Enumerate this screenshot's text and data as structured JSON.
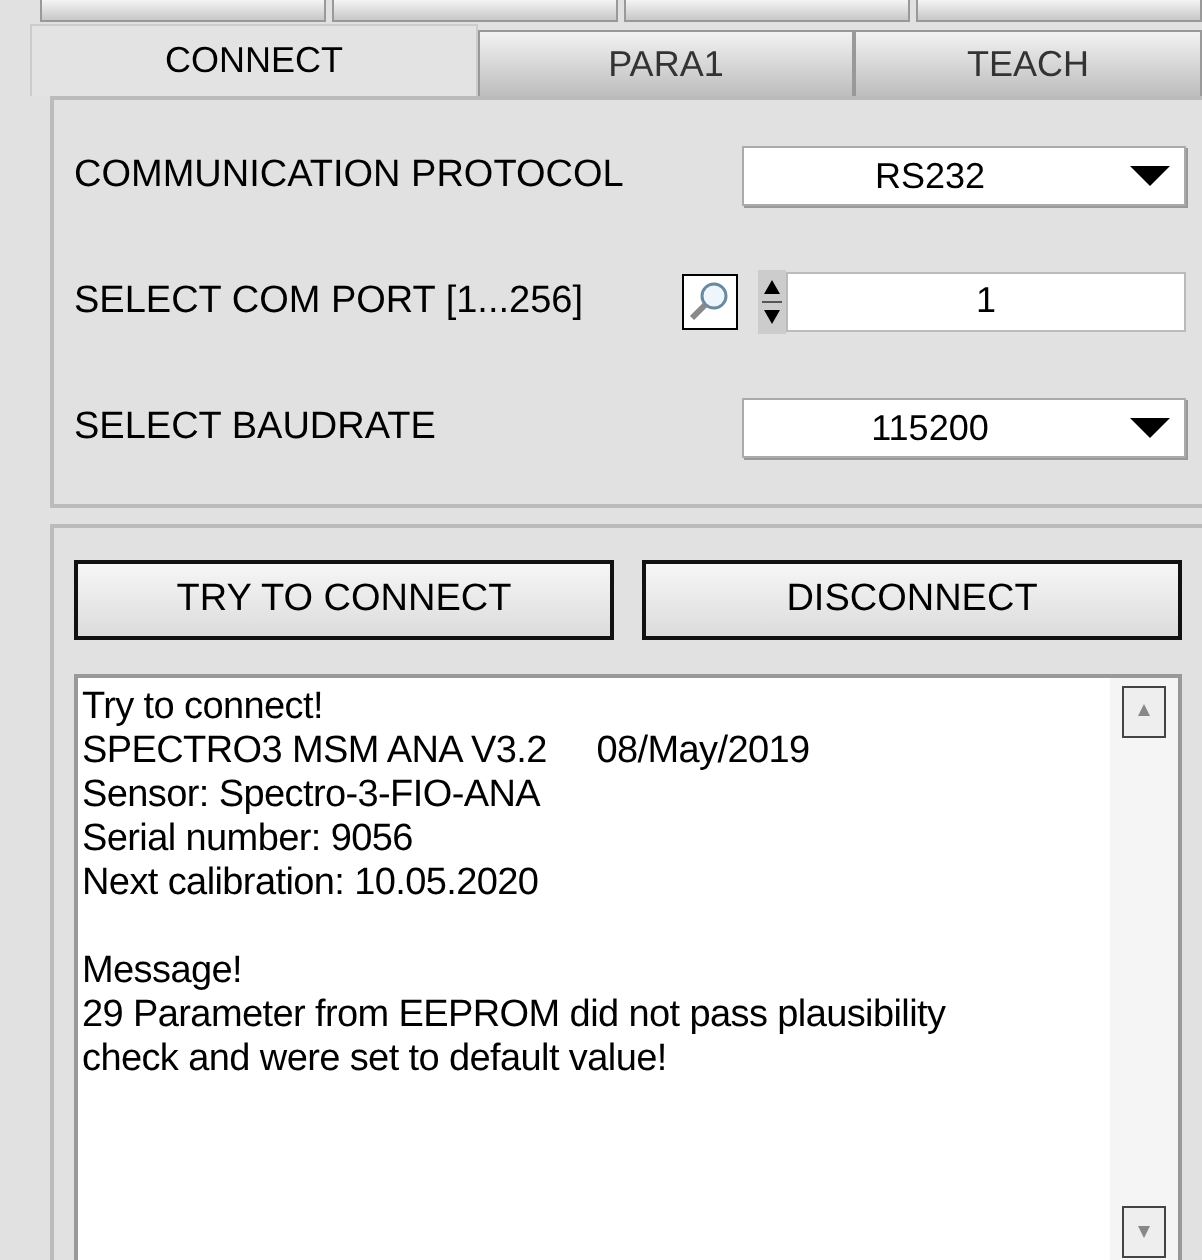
{
  "tabs": [
    {
      "label": "CONNECT",
      "selected": true
    },
    {
      "label": "PARA1",
      "selected": false
    },
    {
      "label": "TEACH",
      "selected": false
    }
  ],
  "settings": [
    {
      "kind": "dropdown",
      "label": "COMMUNICATION PROTOCOL",
      "value": "RS232"
    },
    {
      "kind": "spinner",
      "label": "SELECT COM PORT [1...256]",
      "value": "1"
    },
    {
      "kind": "dropdown",
      "label": "SELECT BAUDRATE",
      "value": "115200"
    }
  ],
  "buttons": [
    "TRY TO CONNECT",
    "DISCONNECT"
  ],
  "log": [
    [
      "Try to connect!",
      "SPECTRO3 MSM ANA V3.2     08/May/2019",
      "Sensor: Spectro-3-FIO-ANA",
      "Serial number: 9056",
      "Next calibration: 10.05.2020"
    ],
    [
      "Message!",
      "29 Parameter from EEPROM did not pass plausibility",
      "check and were set to default value!"
    ]
  ]
}
